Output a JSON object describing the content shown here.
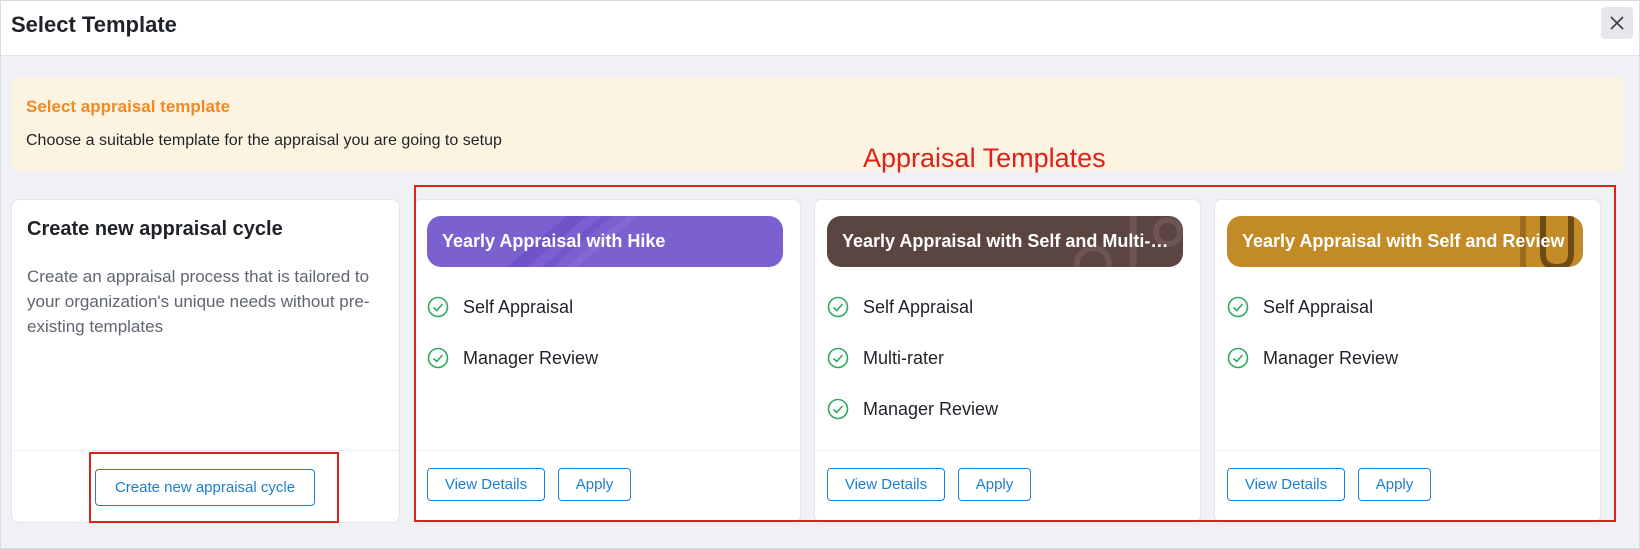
{
  "dialog": {
    "title": "Select Template"
  },
  "banner": {
    "title": "Select appraisal template",
    "description": "Choose a suitable template for the appraisal you are going to setup"
  },
  "annotation": {
    "label": "Appraisal Templates"
  },
  "create_card": {
    "title": "Create new appraisal cycle",
    "description": "Create an appraisal process that is tailored to your organization's unique needs without pre-existing templates",
    "button_label": "Create new appraisal cycle"
  },
  "templates": [
    {
      "name": "Yearly Appraisal with Hike",
      "color": "#7b61cf",
      "features": [
        "Self Appraisal",
        "Manager Review"
      ],
      "view_label": "View Details",
      "apply_label": "Apply"
    },
    {
      "name": "Yearly Appraisal with Self and Multi-rater",
      "color": "#5b4541",
      "features": [
        "Self Appraisal",
        "Multi-rater",
        "Manager Review"
      ],
      "view_label": "View Details",
      "apply_label": "Apply"
    },
    {
      "name": "Yearly Appraisal with Self and Review",
      "color": "#c28b27",
      "features": [
        "Self Appraisal",
        "Manager Review"
      ],
      "view_label": "View Details",
      "apply_label": "Apply"
    }
  ],
  "colors": {
    "accent": "#1b7fd0",
    "banner_title": "#f08a24",
    "banner_bg": "#fdf3e1",
    "check": "#2eaa5e",
    "annotation": "#e0201b"
  },
  "icons": {
    "close": "close-icon",
    "check": "check-circle-icon"
  }
}
